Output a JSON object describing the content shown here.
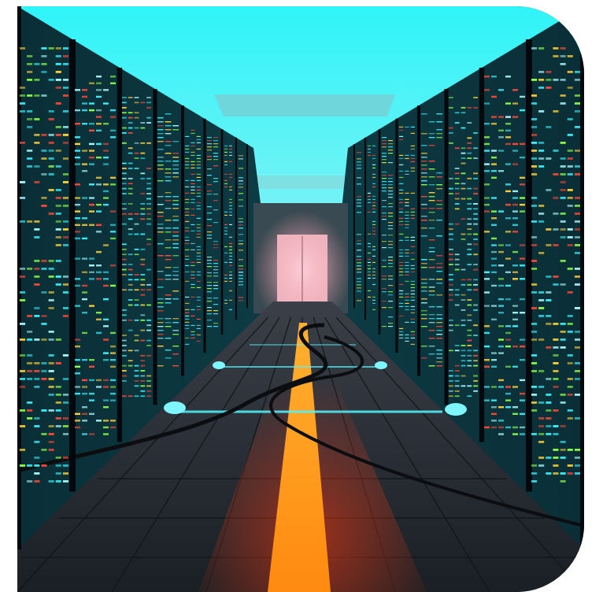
{
  "image": {
    "subject": "server-room-corridor",
    "colors": {
      "ceiling_glow": "#22e8f0",
      "rack_dark": "#07141b",
      "floor": "#2a3640",
      "center_stripe": "#ff9a1a",
      "stripe_glow": "#ff3a10",
      "led_cyan": "#39f3ff",
      "led_green": "#8cff4a",
      "led_yellow": "#ffd23a",
      "led_red": "#ff4a3a"
    }
  }
}
